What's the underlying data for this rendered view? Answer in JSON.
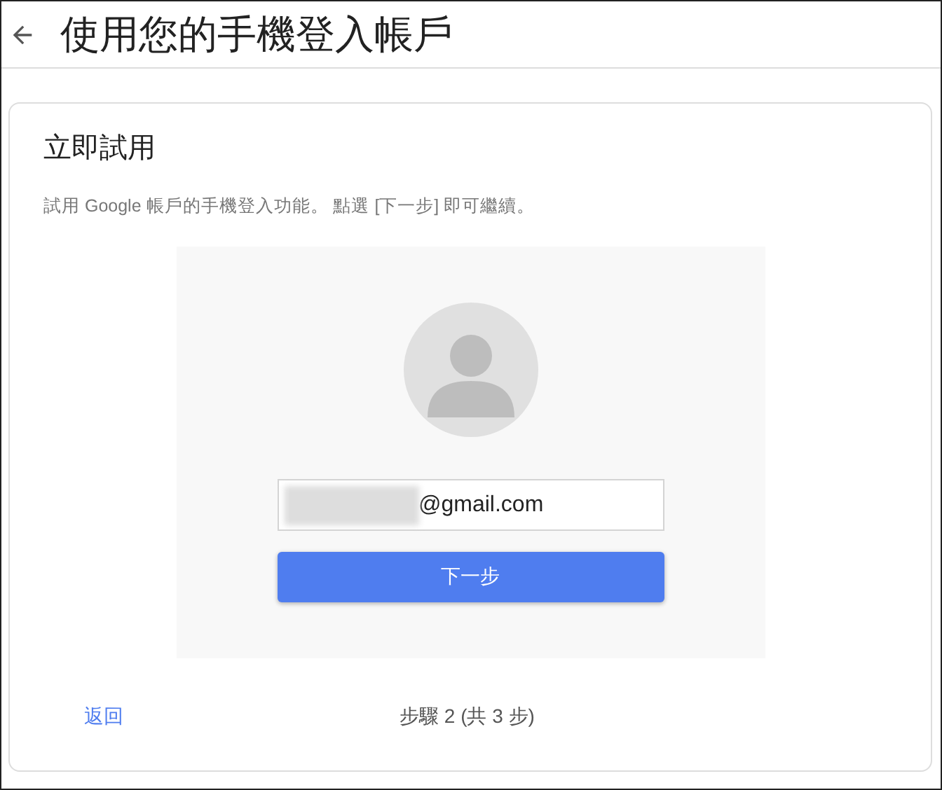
{
  "header": {
    "title": "使用您的手機登入帳戶"
  },
  "card": {
    "title": "立即試用",
    "description": "試用 Google 帳戶的手機登入功能。 點選 [下一步] 即可繼續。"
  },
  "email_field": {
    "value": "@gmail.com",
    "redacted": true
  },
  "next_button": "下一步",
  "back_link": "返回",
  "step_text": "步驟 2 (共 3 步)"
}
